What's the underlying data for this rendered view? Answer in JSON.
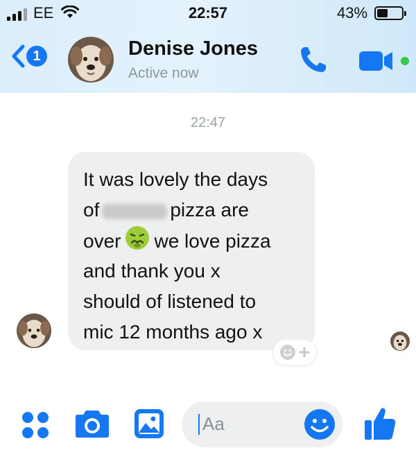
{
  "status_bar": {
    "carrier": "EE",
    "time": "22:57",
    "battery_percent": "43%",
    "battery_level": 0.43
  },
  "header": {
    "back_badge": "1",
    "contact_name": "Denise Jones",
    "contact_status": "Active now",
    "icons": [
      "back-chevron-icon",
      "phone-icon",
      "video-camera-icon"
    ],
    "accent_color": "#1677f2",
    "online_color": "#35c94a"
  },
  "conversation": {
    "timestamp": "22:47",
    "message": {
      "line1": "It was lovely the days",
      "line2_start": "of",
      "line2_end": "pizza are",
      "line3_start": "over",
      "line3_end": "we love pizza",
      "line4": "and thank you x",
      "line5": "should of listened to",
      "line6": "mic 12 months ago x",
      "emoji": "nauseated-face-emoji"
    }
  },
  "composer": {
    "placeholder": "Aa",
    "icons": [
      "apps-grid-icon",
      "camera-icon",
      "photo-gallery-icon",
      "smiley-icon",
      "thumbs-up-icon"
    ]
  }
}
